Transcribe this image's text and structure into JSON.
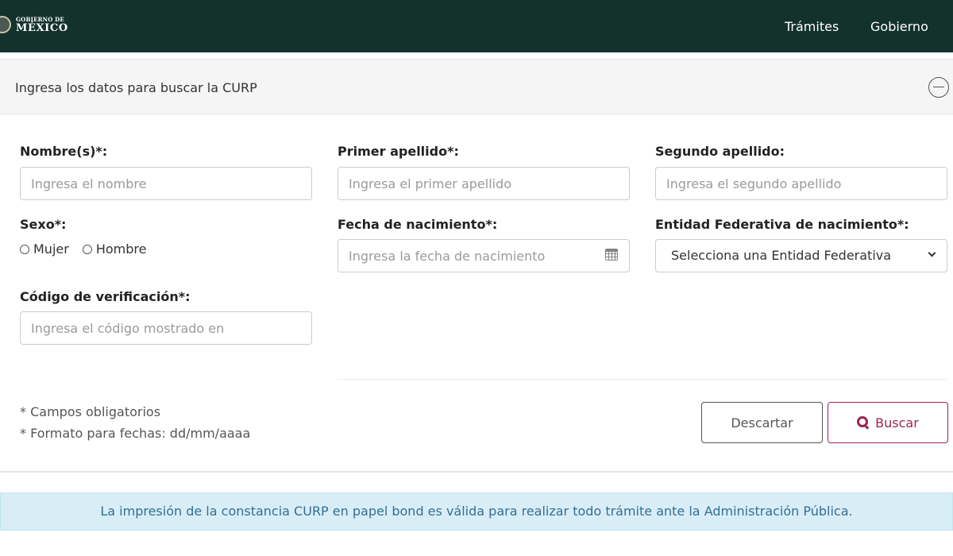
{
  "header": {
    "logo_small": "GOBIERNO DE",
    "logo_big": "MÉXICO",
    "nav": [
      "Trámites",
      "Gobierno"
    ]
  },
  "panel": {
    "title": "Ingresa los datos para buscar la CURP",
    "collapse_icon": "minus-circle-icon"
  },
  "form": {
    "nombre": {
      "label": "Nombre(s)*:",
      "placeholder": "Ingresa el nombre"
    },
    "primer_apellido": {
      "label": "Primer apellido*:",
      "placeholder": "Ingresa el primer apellido"
    },
    "segundo_apellido": {
      "label": "Segundo apellido:",
      "placeholder": "Ingresa el segundo apellido"
    },
    "sexo": {
      "label": "Sexo*:",
      "options": [
        "Mujer",
        "Hombre"
      ]
    },
    "fecha": {
      "label": "Fecha de nacimiento*:",
      "placeholder": "Ingresa la fecha de nacimiento",
      "icon": "calendar-icon"
    },
    "entidad": {
      "label": "Entidad Federativa de nacimiento*:",
      "selected": "Selecciona una Entidad Federativa"
    },
    "codigo": {
      "label": "Código de verificación*:",
      "placeholder": "Ingresa el código mostrado en"
    }
  },
  "notes": [
    "* Campos obligatorios",
    "* Formato para fechas: dd/mm/aaaa"
  ],
  "buttons": {
    "descartar": "Descartar",
    "buscar": "Buscar"
  },
  "info_message": "La impresión de la constancia CURP en papel bond es válida para realizar todo trámite ante la Administración Pública.",
  "colors": {
    "header_bg": "#13322b",
    "accent": "#9d2449",
    "info_bg": "#d9edf7",
    "info_text": "#31708f"
  }
}
